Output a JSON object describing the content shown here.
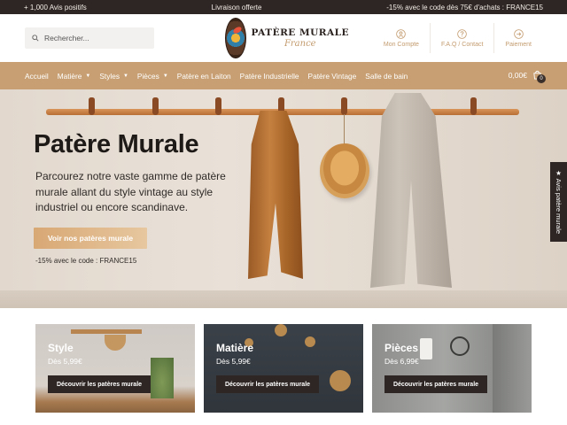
{
  "topbar": {
    "left": "+ 1,000 Avis positifs",
    "center": "Livraison offerte",
    "right": "-15% avec le code dès 75€ d'achats : FRANCE15"
  },
  "search": {
    "placeholder": "Rechercher..."
  },
  "logo": {
    "title": "PATÈRE MURALE",
    "subtitle": "France"
  },
  "header_links": [
    {
      "label": "Mon Compte",
      "icon": "user-icon"
    },
    {
      "label": "F.A.Q / Contact",
      "icon": "help-icon"
    },
    {
      "label": "Paiement",
      "icon": "arrow-right-icon"
    }
  ],
  "nav": {
    "items": [
      {
        "label": "Accueil",
        "dropdown": false
      },
      {
        "label": "Matière",
        "dropdown": true
      },
      {
        "label": "Styles",
        "dropdown": true
      },
      {
        "label": "Pièces",
        "dropdown": true
      },
      {
        "label": "Patère en Laiton",
        "dropdown": false
      },
      {
        "label": "Patère Industrielle",
        "dropdown": false
      },
      {
        "label": "Patère Vintage",
        "dropdown": false
      },
      {
        "label": "Salle de bain",
        "dropdown": false
      }
    ],
    "cart_total": "0,00€",
    "cart_count": "0"
  },
  "hero": {
    "title": "Patère Murale",
    "description": "Parcourez notre vaste gamme de patère murale allant du style vintage au style industriel ou encore scandinave.",
    "button": "Voir nos patères murale",
    "promo": "-15% avec le code : FRANCE15"
  },
  "side_tab": "★ Avis patère murale",
  "cards": [
    {
      "title": "Style",
      "price": "Dès 5,99€",
      "button": "Découvrir les patères murale"
    },
    {
      "title": "Matière",
      "price": "Dès 5,99€",
      "button": "Découvrir les patères murale"
    },
    {
      "title": "Pièces",
      "price": "Dès 6,99€",
      "button": "Découvrir les patères murale"
    }
  ],
  "colors": {
    "topbar_bg": "#2e2624",
    "accent": "#c79f72",
    "dark_button": "#2e2624"
  }
}
